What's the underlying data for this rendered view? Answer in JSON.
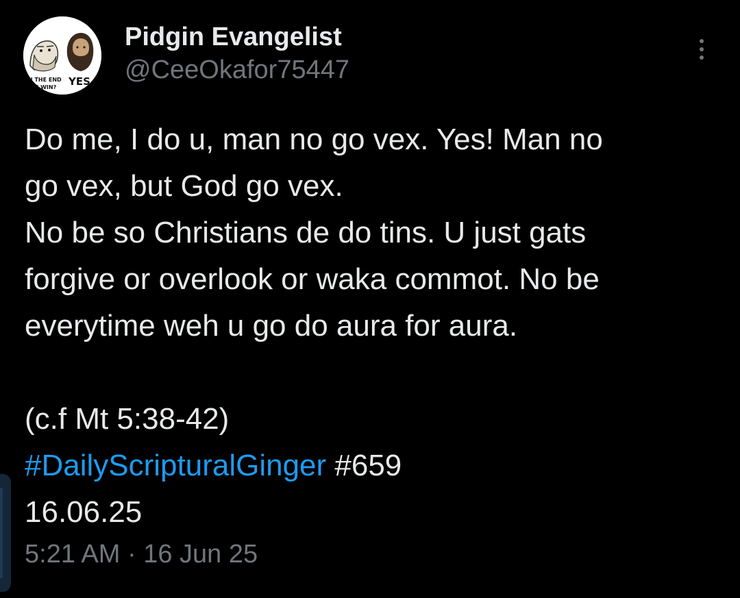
{
  "tweet": {
    "author": {
      "display_name": "Pidgin Evangelist",
      "handle": "@CeeOkafor75447",
      "avatar": {
        "left_caption_line1": "IN THE END",
        "left_caption_line2": "WE WIN?",
        "right_caption": "YES"
      }
    },
    "more_icon": "more-vertical-icon",
    "body": {
      "line1": "Do me, I do u, man no go vex. Yes! Man no",
      "line2": "go vex, but God go vex.",
      "line3": "No be so Christians de do tins. U just gats",
      "line4": "forgive or overlook or waka commot. No be",
      "line5": "everytime weh u go do aura for aura.",
      "line6": "(c.f Mt 5:38-42)",
      "hashtag": "#DailyScripturalGinger",
      "hashtag_suffix": " #659",
      "date_line": "16.06.25"
    },
    "timestamp": "5:21 AM · 16 Jun 25"
  },
  "colors": {
    "background": "#000000",
    "primary_text": "#e7e9ea",
    "secondary_text": "#71767b",
    "link": "#1d9bf0"
  }
}
